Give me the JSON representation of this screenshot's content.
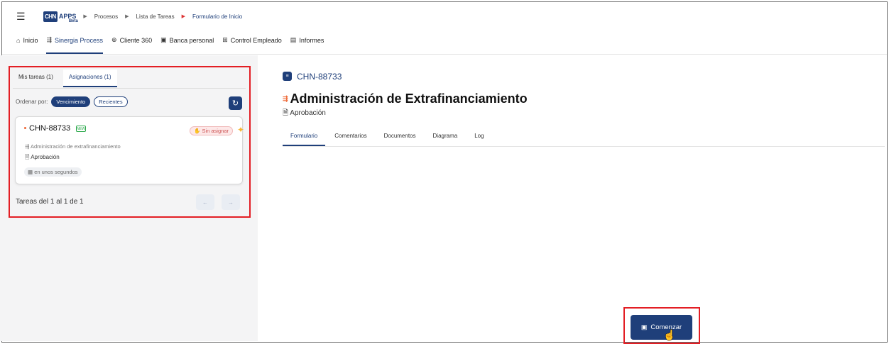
{
  "header": {
    "menu_icon": "hamburger-icon",
    "logo_text": "CHN",
    "logo_apps": "APPS",
    "logo_beta": "Beta",
    "breadcrumb": [
      "Procesos",
      "Lista de Tareas",
      "Formulario de Inicio"
    ]
  },
  "nav": {
    "items": [
      {
        "label": "Inicio",
        "icon": "home-icon"
      },
      {
        "label": "Sinergia Process",
        "icon": "process-icon"
      },
      {
        "label": "Cliente 360",
        "icon": "client-icon"
      },
      {
        "label": "Banca personal",
        "icon": "bank-icon"
      },
      {
        "label": "Control Empleado",
        "icon": "employee-icon"
      },
      {
        "label": "Informes",
        "icon": "report-icon"
      }
    ],
    "active": "Sinergia Process"
  },
  "left": {
    "tabs": [
      "Mis tareas (1)",
      "Asignaciones (1)"
    ],
    "active_tab": "Asignaciones (1)",
    "sort_label": "Ordenar por:",
    "sort_options": [
      "Vencimiento",
      "Recientes"
    ],
    "card": {
      "id": "CHN-88733",
      "badge": "NEW",
      "status": "Sin asignar",
      "process": "Administración de extrafinanciamiento",
      "step": "Aprobación",
      "time": "en unos segundos"
    },
    "pager_text": "Tareas del 1 al 1 de 1",
    "prev": "←",
    "next": "→"
  },
  "main": {
    "task_id": "CHN-88733",
    "title": "Administración de Extrafinanciamiento",
    "subtitle": "Aprobación",
    "tabs": [
      "Formulario",
      "Comentarios",
      "Documentos",
      "Diagrama",
      "Log"
    ],
    "active_tab": "Formulario",
    "start_button": "Comenzar"
  },
  "colors": {
    "primary": "#1f3f7a",
    "highlight": "#e31e24",
    "panel_bg": "#f4f4f5"
  }
}
